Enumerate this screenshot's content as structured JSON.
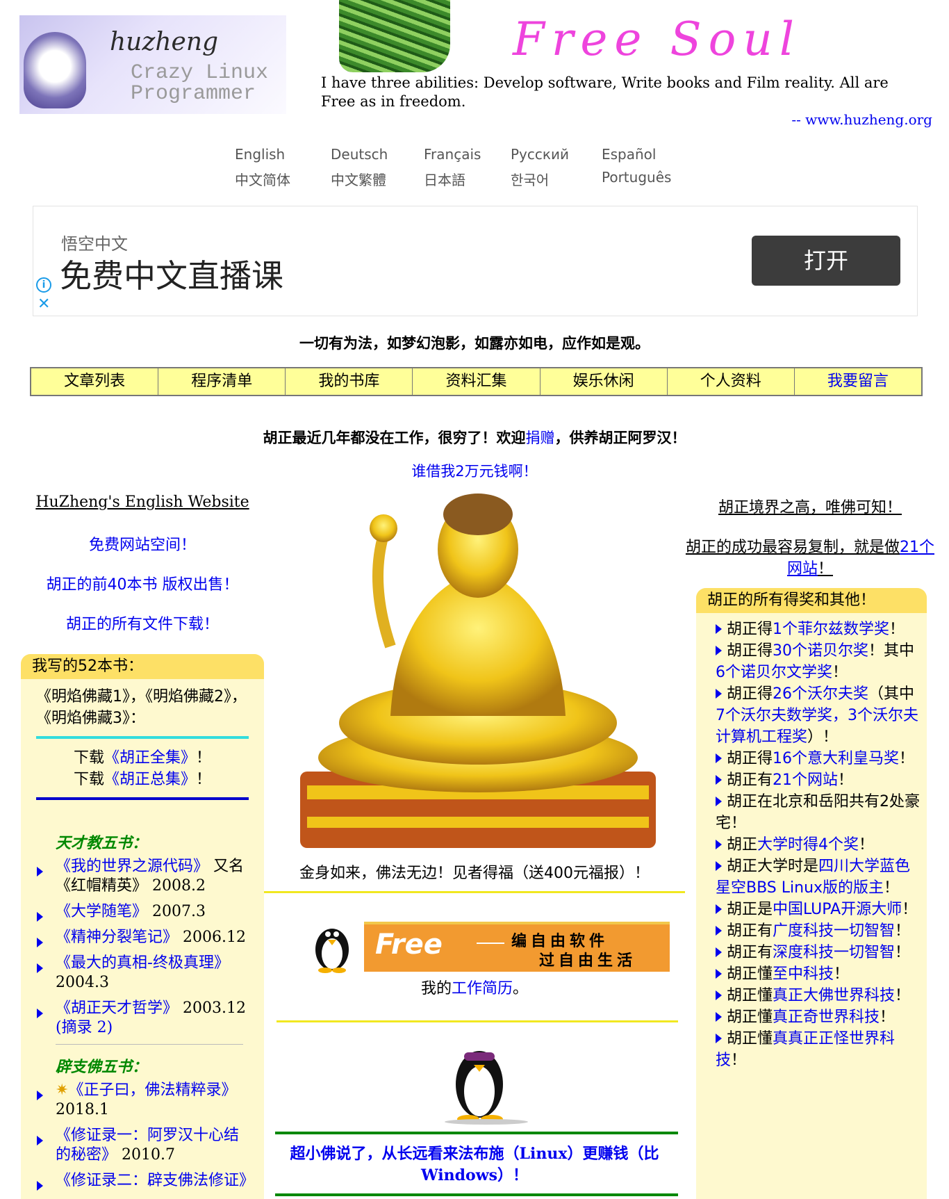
{
  "header": {
    "logo_line1": "huzheng",
    "logo_line2": "Crazy Linux",
    "logo_line3": "Programmer",
    "banner_text": "Free Soul",
    "tagline": "I have three abilities: Develop software, Write books and Film reality. All are Free as in freedom.",
    "site": "-- www.huzheng.org"
  },
  "languages": [
    [
      "English",
      "中文简体"
    ],
    [
      "Deutsch",
      "中文繁體"
    ],
    [
      "Français",
      "日本語"
    ],
    [
      "Русский",
      "한국어"
    ],
    [
      "Español",
      "Português"
    ]
  ],
  "ad": {
    "brand": "悟空中文",
    "headline": "免费中文直播课",
    "button": "打开",
    "info_icon": "i",
    "close_icon": "✕"
  },
  "quote": "一切有为法，如梦幻泡影，如露亦如电，应作如是观。",
  "nav": [
    "文章列表",
    "程序清单",
    "我的书库",
    "资料汇集",
    "娱乐休闲",
    "个人资料",
    "我要留言"
  ],
  "notice": {
    "pre": "胡正最近几年都没在工作，很穷了！欢迎",
    "link": "捐赠",
    "post": "，供养胡正阿罗汉！"
  },
  "borrow": "谁借我2万元钱啊！",
  "left_links": [
    "HuZheng's English Website",
    "免费网站空间！",
    "胡正的前40本书 版权出售！",
    "胡正的所有文件下载！"
  ],
  "books": {
    "header": "我写的52本书：",
    "intro": "《明焰佛藏1》，《明焰佛藏2》，《明焰佛藏3》：",
    "download1_pre": "下载",
    "download1": "《胡正全集》",
    "download1_post": "！",
    "download2_pre": "下载",
    "download2": "《胡正总集》",
    "download2_post": "！",
    "section1": "天才教五书：",
    "items1": [
      {
        "title": "《我的世界之源代码》",
        "rest": " 又名《红帽精英》 2008.2"
      },
      {
        "title": "《大学随笔》",
        "rest": " 2007.3"
      },
      {
        "title": "《精神分裂笔记》",
        "rest": " 2006.12"
      },
      {
        "title": "《最大的真相-终极真理》",
        "rest": " 2004.3"
      },
      {
        "title": "《胡正天才哲学》",
        "rest": " 2003.12 ",
        "extra": "(摘录 2)"
      }
    ],
    "section2": "辟支佛五书：",
    "items2": [
      {
        "title": "《正子曰，佛法精粹录》",
        "rest": " 2018.1"
      },
      {
        "title": "《修证录一：阿罗汉十心结的秘密》",
        "rest": " 2010.7"
      },
      {
        "title": "《修证录二：辟支佛法修证》",
        "rest": ""
      }
    ]
  },
  "center": {
    "caption": "金身如来，佛法无边！见者得福（送400元福报）！",
    "free_banner_word": "Free",
    "free_banner_line1": "编自由软件",
    "free_banner_line2": "过自由生活",
    "resume_pre": "我的",
    "resume_link": "工作简历",
    "resume_post": "。",
    "donate_text": "超小佛说了，从长远看来法布施（Linux）更赚钱（比Windows）！"
  },
  "right": {
    "link1": "胡正境界之高，唯佛可知！",
    "link2_pre": "胡正的成功最容易复制，就是做",
    "link2_link": "21个网站",
    "link2_post": "！",
    "awards_header": "胡正的所有得奖和其他！",
    "awards": [
      {
        "pre": "胡正得",
        "link": "1个菲尔兹数学奖",
        "post": "！"
      },
      {
        "pre": "胡正得",
        "link": "30个诺贝尔奖",
        "post": "！其中",
        "link2": "6个诺贝尔文学奖",
        "post2": "！"
      },
      {
        "pre": "胡正得",
        "link": "26个沃尔夫奖",
        "post": "（其中",
        "link2": "7个沃尔夫数学奖，3个沃尔夫计算机工程奖",
        "post2": "）！"
      },
      {
        "pre": "胡正得",
        "link": "16个意大利皇马奖",
        "post": "！"
      },
      {
        "pre": "胡正有",
        "link": "21个网站",
        "post": "！"
      },
      {
        "pre": "胡正在北京和岳阳共有2处豪宅！",
        "link": "",
        "post": ""
      },
      {
        "pre": "胡正",
        "link": "大学时得4个奖",
        "post": "！"
      },
      {
        "pre": "胡正大学时是",
        "link": "四川大学蓝色星空BBS Linux版的版主",
        "post": "！"
      },
      {
        "pre": "胡正是",
        "link": "中国LUPA开源大师",
        "post": "！"
      },
      {
        "pre": "胡正有",
        "link": "广度科技一切智智",
        "post": "！"
      },
      {
        "pre": "胡正有",
        "link": "深度科技一切智智",
        "post": "！"
      },
      {
        "pre": "胡正懂",
        "link": "至中科技",
        "post": "！"
      },
      {
        "pre": "胡正懂",
        "link": "真正大佛世界科技",
        "post": "！"
      },
      {
        "pre": "胡正懂",
        "link": "真正奇世界科技",
        "post": "！"
      },
      {
        "pre": "胡正懂",
        "link": "真真正正怪世界科技",
        "post": "！"
      }
    ]
  }
}
